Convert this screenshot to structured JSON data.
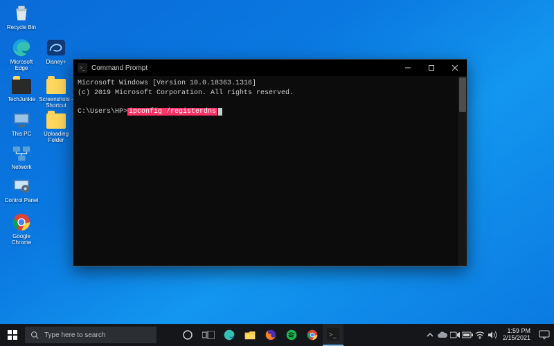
{
  "desktop": {
    "icons": [
      {
        "label": "Recycle Bin"
      },
      {
        "label": "Microsoft Edge"
      },
      {
        "label": "Disney+"
      },
      {
        "label": "TechJunkie"
      },
      {
        "label": "Screenshots - Shortcut"
      },
      {
        "label": "This PC"
      },
      {
        "label": "Uploading Folder"
      },
      {
        "label": "Network"
      },
      {
        "label": "Control Panel"
      },
      {
        "label": "Google Chrome"
      }
    ]
  },
  "cmd": {
    "title": "Command Prompt",
    "line1": "Microsoft Windows [Version 10.0.18363.1316]",
    "line2": "(c) 2019 Microsoft Corporation. All rights reserved.",
    "prompt_prefix": "C:\\Users\\HP>",
    "command_highlight": "ipconfig /registerdns"
  },
  "taskbar": {
    "search_placeholder": "Type here to search",
    "time": "1:59 PM",
    "date": "2/15/2021"
  }
}
